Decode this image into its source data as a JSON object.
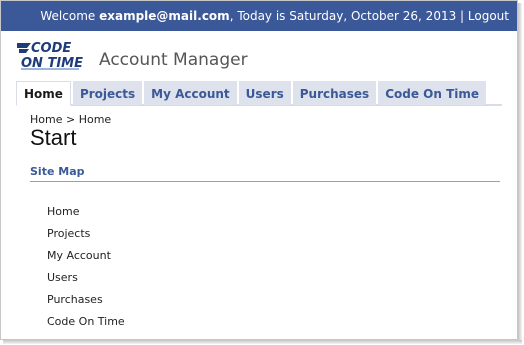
{
  "header": {
    "welcome_prefix": "Welcome",
    "user_email": "example@mail.com",
    "date_text": ", Today is Saturday, October 26, 2013 |",
    "logout_label": "Logout"
  },
  "logo": {
    "line1": "CODE",
    "line2": "ON TIME"
  },
  "app": {
    "title": "Account Manager"
  },
  "tabs": [
    {
      "label": "Home",
      "active": true
    },
    {
      "label": "Projects"
    },
    {
      "label": "My Account"
    },
    {
      "label": "Users"
    },
    {
      "label": "Purchases"
    },
    {
      "label": "Code On Time"
    }
  ],
  "breadcrumb": {
    "root": "Home",
    "separator": ">",
    "current": "Home"
  },
  "page": {
    "title": "Start"
  },
  "sitemap": {
    "title": "Site Map",
    "items": [
      "Home",
      "Projects",
      "My Account",
      "Users",
      "Purchases",
      "Code On Time"
    ]
  },
  "colors": {
    "header_bg": "#3b5998",
    "tab_bg": "#dde2ec",
    "tab_text": "#3b5998"
  }
}
